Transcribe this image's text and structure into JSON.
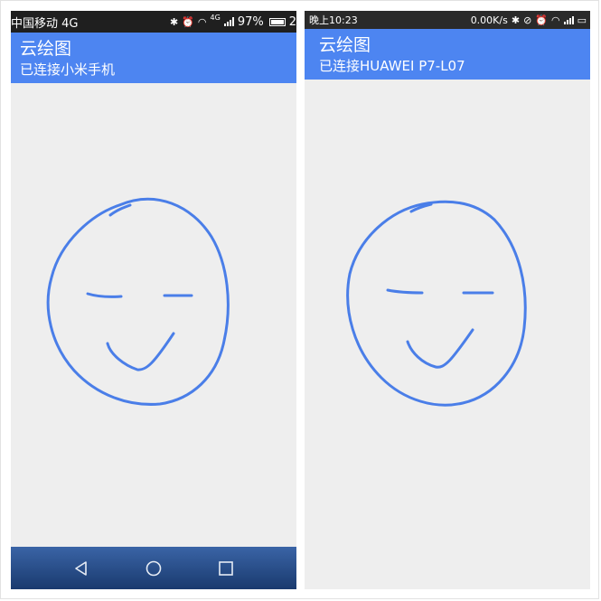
{
  "left_phone": {
    "status_bar": {
      "carrier": "中国移动 4G",
      "network_badge": "4G",
      "battery_percent": "97%",
      "overflow": "2"
    },
    "app": {
      "title": "云绘图",
      "subtitle": "已连接小米手机"
    },
    "nav": {
      "back_icon": "back-triangle-icon",
      "home_icon": "home-circle-icon",
      "recents_icon": "recents-square-icon"
    }
  },
  "right_phone": {
    "status_bar": {
      "time": "晚上10:23",
      "net_speed": "0.00K/s"
    },
    "app": {
      "title": "云绘图",
      "subtitle": "已连接HUAWEI P7-L07"
    }
  },
  "colors": {
    "app_bar": "#4d85f1",
    "stroke": "#4a7ee8",
    "canvas_bg": "#eeeeee",
    "nav_bar": "#2a4f8c"
  }
}
